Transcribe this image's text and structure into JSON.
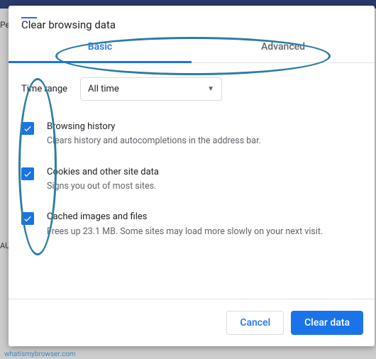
{
  "dialog": {
    "title": "Clear browsing data"
  },
  "tabs": {
    "basic": "Basic",
    "advanced": "Advanced"
  },
  "timeRange": {
    "label": "Time range",
    "value": "All time"
  },
  "options": [
    {
      "title": "Browsing history",
      "desc": "Clears history and autocompletions in the address bar."
    },
    {
      "title": "Cookies and other site data",
      "desc": "Signs you out of most sites."
    },
    {
      "title": "Cached images and files",
      "desc": "Frees up 23.1 MB. Some sites may load more slowly on your next visit."
    }
  ],
  "footer": {
    "cancel": "Cancel",
    "clear": "Clear data"
  },
  "bg": {
    "left1": "Pe",
    "left2": "AU",
    "watermark": "whatismybrowser.com"
  }
}
